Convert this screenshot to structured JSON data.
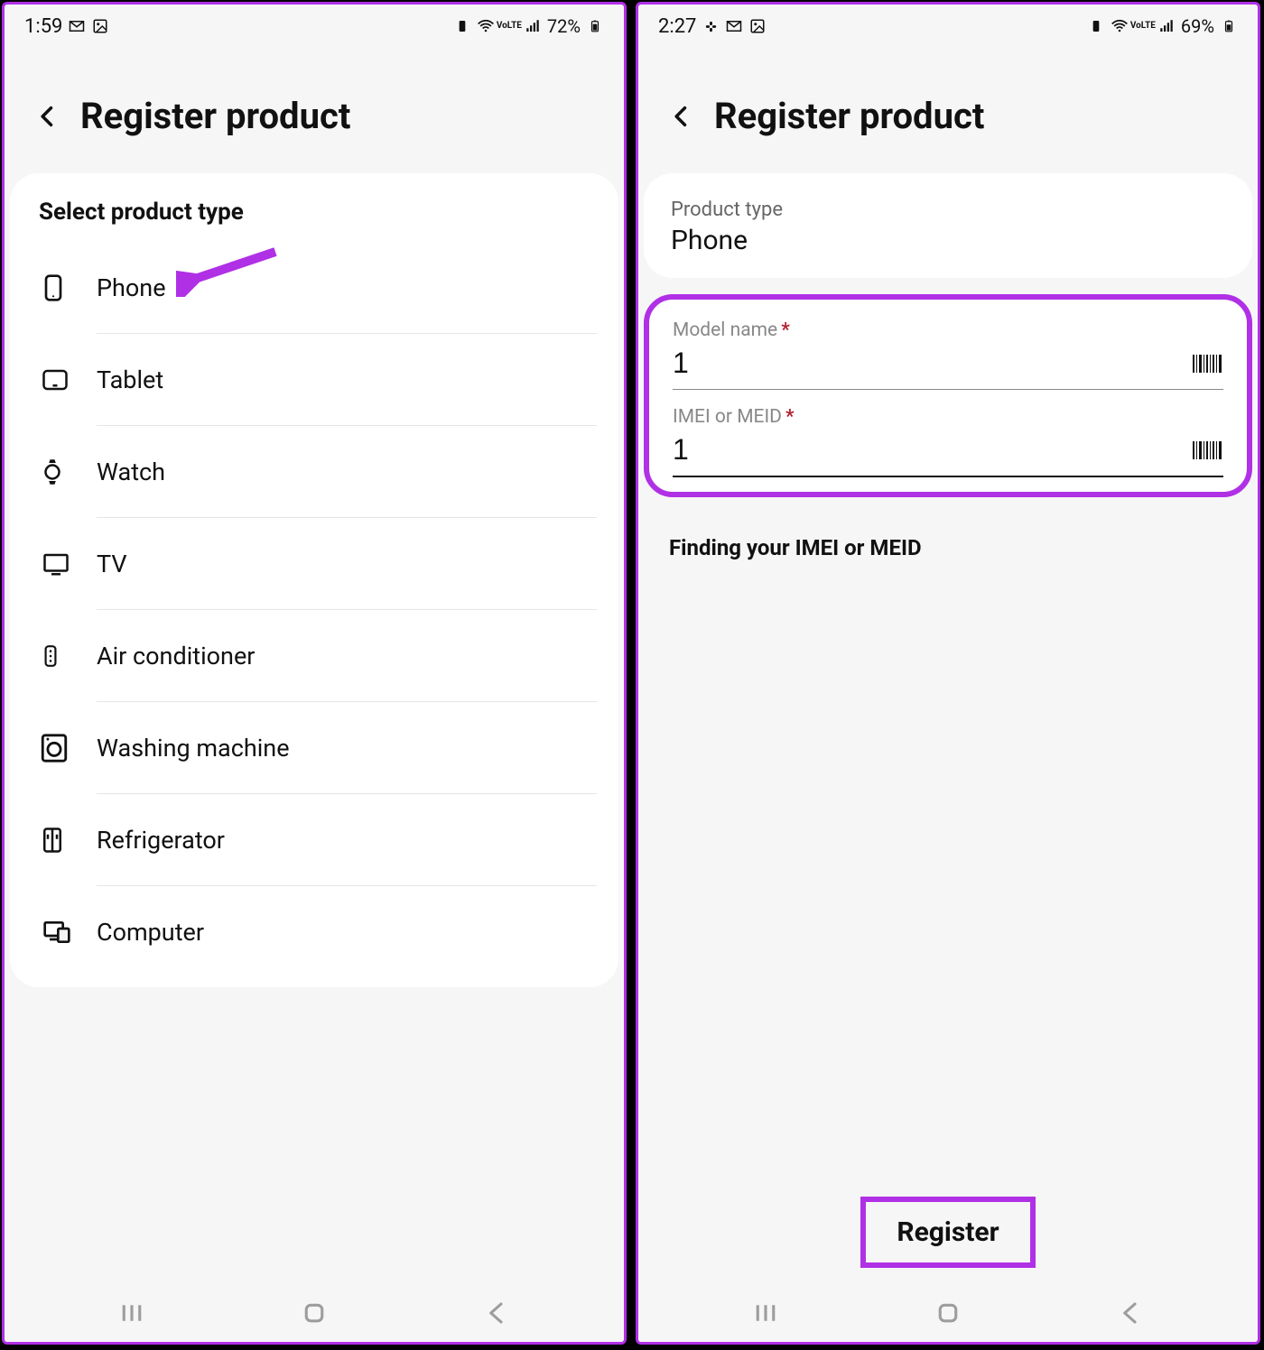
{
  "left": {
    "status": {
      "time": "1:59",
      "battery": "72%",
      "volte": "VoLTE"
    },
    "header": {
      "title": "Register product"
    },
    "section": {
      "title": "Select product type"
    },
    "items": [
      {
        "label": "Phone"
      },
      {
        "label": "Tablet"
      },
      {
        "label": "Watch"
      },
      {
        "label": "TV"
      },
      {
        "label": "Air conditioner"
      },
      {
        "label": "Washing machine"
      },
      {
        "label": "Refrigerator"
      },
      {
        "label": "Computer"
      }
    ]
  },
  "right": {
    "status": {
      "time": "2:27",
      "battery": "69%",
      "volte": "VoLTE"
    },
    "header": {
      "title": "Register product"
    },
    "product_type_label": "Product type",
    "product_type_value": "Phone",
    "fields": {
      "model": {
        "label": "Model name",
        "value": "1"
      },
      "imei": {
        "label": "IMEI or MEID",
        "value": "1"
      }
    },
    "finding_label": "Finding your IMEI or MEID",
    "register_label": "Register"
  },
  "asterisk": "*"
}
